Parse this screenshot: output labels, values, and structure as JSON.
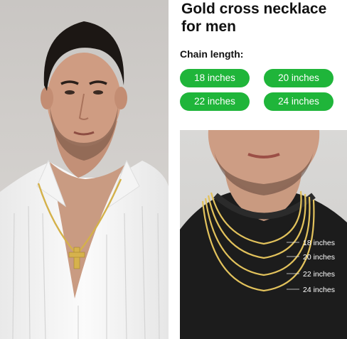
{
  "product": {
    "title": "Gold cross necklace for men"
  },
  "chain_length": {
    "label": "Chain length:",
    "options": [
      "18 inches",
      "20 inches",
      "22 inches",
      "24 inches"
    ],
    "accent_color": "#1fb53a"
  },
  "diagram": {
    "lengths": [
      "18 inches",
      "20 inches",
      "22 inches",
      "24 inches"
    ]
  }
}
